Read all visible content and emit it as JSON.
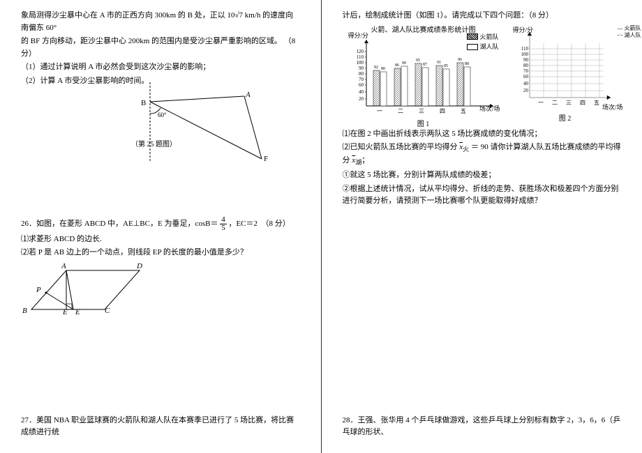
{
  "left": {
    "p25_l1": "象局测得沙尘暴中心在 A 市的正西方向 300km 的 B 处，正以 10√7 km/h 的速度向南偏东 60°",
    "p25_l2": "的 BF 方向移动，距沙尘暴中心 200km 的范围内是受沙尘暴严重影响的区域。 （8 分）",
    "p25_q1": "（1）通过计算说明 A 市必然会受到这次沙尘暴的影响；",
    "p25_q2": "（2）计算 A 市受沙尘暴影响的时间。",
    "fig25_labels": {
      "B": "B",
      "A": "A",
      "F": "F",
      "angle": "60°"
    },
    "fig25_caption": "（第 25 题图）",
    "p26_head": "26．如图，在菱形 ABCD 中，AE⊥BC，E 为垂足，cosB＝",
    "p26_frac_n": "4",
    "p26_frac_d": "5",
    "p26_tail": "，EC＝2　（8 分）",
    "p26_q1": "⑴求菱形 ABCD 的边长.",
    "p26_q2": "⑵若 P 是 AB 边上的一个动点，则线段 EP 的长度的最小值是多少？",
    "fig26_labels": {
      "A": "A",
      "B": "B",
      "C": "C",
      "D": "D",
      "E": "E",
      "P": "P"
    },
    "p27": "27．美国 NBA 职业篮球赛的火箭队和湖人队在本赛季已进行了 5 场比赛，将比赛成绩进行统"
  },
  "right": {
    "p27_cont": "计后，绘制成统计图（如图 1）。请完成以下四个问题：（8 分）",
    "chart_title": "火箭、湖人队比赛成绩条形统计图",
    "legend_a": "火箭队",
    "legend_b": "湖人队",
    "ylabel": "得分/分",
    "xlabel": "场次/场",
    "fig1": "图 1",
    "fig2": "图 2",
    "q1": "⑴在图 2 中画出折线表示两队这 5 场比赛成绩的变化情况；",
    "q2a": "⑵已知火箭队五场比赛的平均得分 ",
    "q2_xbar1": "x",
    "q2_sub1": "火",
    "q2b": " ＝ 90 请你计算湖人队五场比赛成绩的平均得分 ",
    "q2_xbar2": "x",
    "q2_sub2": "湖",
    "q2c": "；",
    "q3": "①就这 5 场比赛，分别计算两队成绩的极差；",
    "q4": "②根据上述统计情况，试从平均得分、折线的走势、获胜场次和极差四个方面分别进行简要分析，请预测下一场比赛哪个队更能取得好成绩？",
    "p28": "28．王强、张华用 4 个乒乓球做游戏，这些乒乓球上分别标有数字 2，3，6，6（乒乓球的形状、"
  },
  "chart_data": [
    {
      "type": "bar",
      "title": "火箭、湖人队比赛成绩条形统计图",
      "categories": [
        "一",
        "二",
        "三",
        "四",
        "五"
      ],
      "series": [
        {
          "name": "火箭队",
          "values": [
            82,
            86,
            95,
            91,
            96
          ]
        },
        {
          "name": "湖人队",
          "values": [
            80,
            90,
            87,
            85,
            88
          ]
        }
      ],
      "xlabel": "场次/场",
      "ylabel": "得分/分",
      "yticks": [
        20,
        40,
        60,
        70,
        80,
        90,
        100,
        110,
        120
      ],
      "ylim": [
        0,
        120
      ]
    },
    {
      "type": "line",
      "title": "",
      "categories": [
        "一",
        "二",
        "三",
        "四",
        "五"
      ],
      "series": [
        {
          "name": "火箭队",
          "values": []
        },
        {
          "name": "湖人队",
          "values": []
        }
      ],
      "xlabel": "场次/场",
      "ylabel": "得分/分",
      "yticks": [
        20,
        40,
        60,
        70,
        80,
        90,
        100,
        110
      ],
      "ylim": [
        0,
        110
      ]
    }
  ]
}
